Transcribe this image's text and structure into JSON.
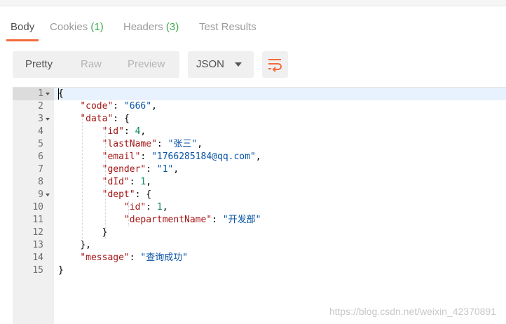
{
  "tabs": [
    {
      "label": "Body",
      "count": ""
    },
    {
      "label": "Cookies ",
      "count": "(1)"
    },
    {
      "label": "Headers ",
      "count": "(3)"
    },
    {
      "label": "Test Results",
      "count": ""
    }
  ],
  "toolbar": {
    "pretty": "Pretty",
    "raw": "Raw",
    "preview": "Preview",
    "format": "JSON",
    "wrap_icon": "wrap-lines-icon",
    "accent": "#f26b3a"
  },
  "editor": {
    "line_numbers": [
      "1",
      "2",
      "3",
      "4",
      "5",
      "6",
      "7",
      "8",
      "9",
      "10",
      "11",
      "12",
      "13",
      "14",
      "15"
    ],
    "lines": {
      "l1": {
        "brace": "{"
      },
      "l2": {
        "key": "\"code\"",
        "value": "\"666\""
      },
      "l3": {
        "key": "\"data\"",
        "brace": "{"
      },
      "l4": {
        "key": "\"id\"",
        "value": "4"
      },
      "l5": {
        "key": "\"lastName\"",
        "value": "\"张三\""
      },
      "l6": {
        "key": "\"email\"",
        "value": "\"1766285184@qq.com\""
      },
      "l7": {
        "key": "\"gender\"",
        "value": "\"1\""
      },
      "l8": {
        "key": "\"dId\"",
        "value": "1"
      },
      "l9": {
        "key": "\"dept\"",
        "brace": "{"
      },
      "l10": {
        "key": "\"id\"",
        "value": "1"
      },
      "l11": {
        "key": "\"departmentName\"",
        "value": "\"开发部\""
      },
      "l12": {
        "brace": "}"
      },
      "l13": {
        "brace": "},"
      },
      "l14": {
        "key": "\"message\"",
        "value": "\"查询成功\""
      },
      "l15": {
        "brace": "}"
      }
    }
  },
  "watermark": "https://blog.csdn.net/weixin_42370891"
}
